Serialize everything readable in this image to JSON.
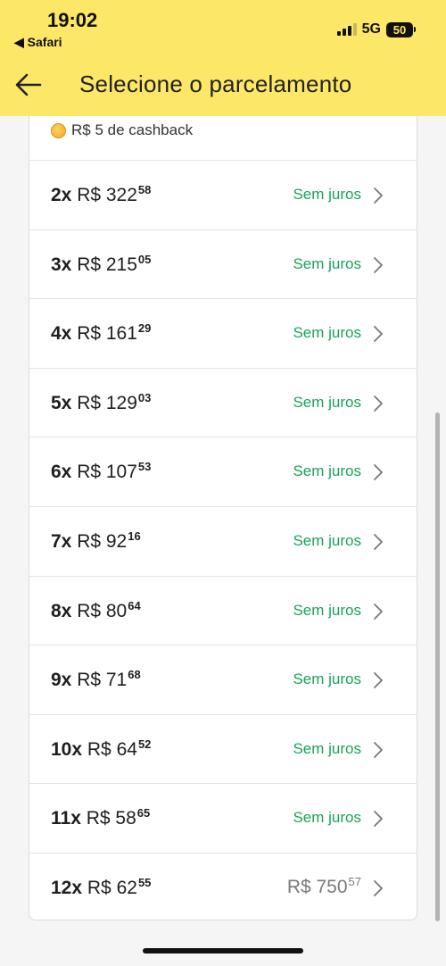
{
  "status": {
    "time": "19:02",
    "back_app": "◀ Safari",
    "network": "5G",
    "battery": "50"
  },
  "header": {
    "title": "Selecione o parcelamento"
  },
  "cashback": {
    "text": "R$ 5 de cashback"
  },
  "options": [
    {
      "count": "2x",
      "price": "R$ 322",
      "cents": "58",
      "tag": "Sem juros"
    },
    {
      "count": "3x",
      "price": "R$ 215",
      "cents": "05",
      "tag": "Sem juros"
    },
    {
      "count": "4x",
      "price": "R$ 161",
      "cents": "29",
      "tag": "Sem juros"
    },
    {
      "count": "5x",
      "price": "R$ 129",
      "cents": "03",
      "tag": "Sem juros"
    },
    {
      "count": "6x",
      "price": "R$ 107",
      "cents": "53",
      "tag": "Sem juros"
    },
    {
      "count": "7x",
      "price": "R$ 92",
      "cents": "16",
      "tag": "Sem juros"
    },
    {
      "count": "8x",
      "price": "R$ 80",
      "cents": "64",
      "tag": "Sem juros"
    },
    {
      "count": "9x",
      "price": "R$ 71",
      "cents": "68",
      "tag": "Sem juros"
    },
    {
      "count": "10x",
      "price": "R$ 64",
      "cents": "52",
      "tag": "Sem juros"
    },
    {
      "count": "11x",
      "price": "R$ 58",
      "cents": "65",
      "tag": "Sem juros"
    },
    {
      "count": "12x",
      "price": "R$ 62",
      "cents": "55",
      "total": "R$ 750",
      "total_cents": "57"
    }
  ],
  "icons": {
    "back": "arrow-left-icon",
    "chevron": "chevron-right-icon",
    "coin": "coin-icon"
  },
  "colors": {
    "header_bg": "#fde766",
    "interest_free": "#19a35a",
    "total_gray": "#7a7a7a"
  }
}
